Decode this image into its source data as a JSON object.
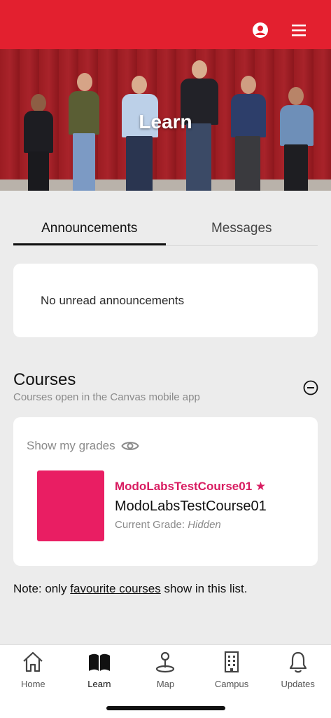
{
  "colors": {
    "brand_red": "#e3202f",
    "course_pink": "#e91e63",
    "fav_pink": "#d81b60"
  },
  "header": {
    "profile_icon": "user-circle-icon",
    "menu_icon": "hamburger-menu-icon"
  },
  "hero": {
    "title": "Learn"
  },
  "tabs": [
    {
      "label": "Announcements",
      "active": true
    },
    {
      "label": "Messages",
      "active": false
    }
  ],
  "announcements": {
    "empty_text": "No unread announcements"
  },
  "courses": {
    "title": "Courses",
    "subtitle": "Courses open in the Canvas mobile app",
    "collapse_icon": "minus-circle-icon",
    "show_grades_label": "Show my grades",
    "items": [
      {
        "favorite_label": "ModoLabsTestCourse01 ★",
        "name": "ModoLabsTestCourse01",
        "grade_prefix": "Current Grade: ",
        "grade_value": "Hidden"
      }
    ]
  },
  "note": {
    "prefix": "Note: only ",
    "link": "favourite courses",
    "suffix": " show in this list."
  },
  "bottom_nav": [
    {
      "label": "Home",
      "icon": "home-icon",
      "active": false
    },
    {
      "label": "Learn",
      "icon": "book-icon",
      "active": true
    },
    {
      "label": "Map",
      "icon": "map-pin-icon",
      "active": false
    },
    {
      "label": "Campus",
      "icon": "building-icon",
      "active": false
    },
    {
      "label": "Updates",
      "icon": "bell-icon",
      "active": false
    }
  ]
}
